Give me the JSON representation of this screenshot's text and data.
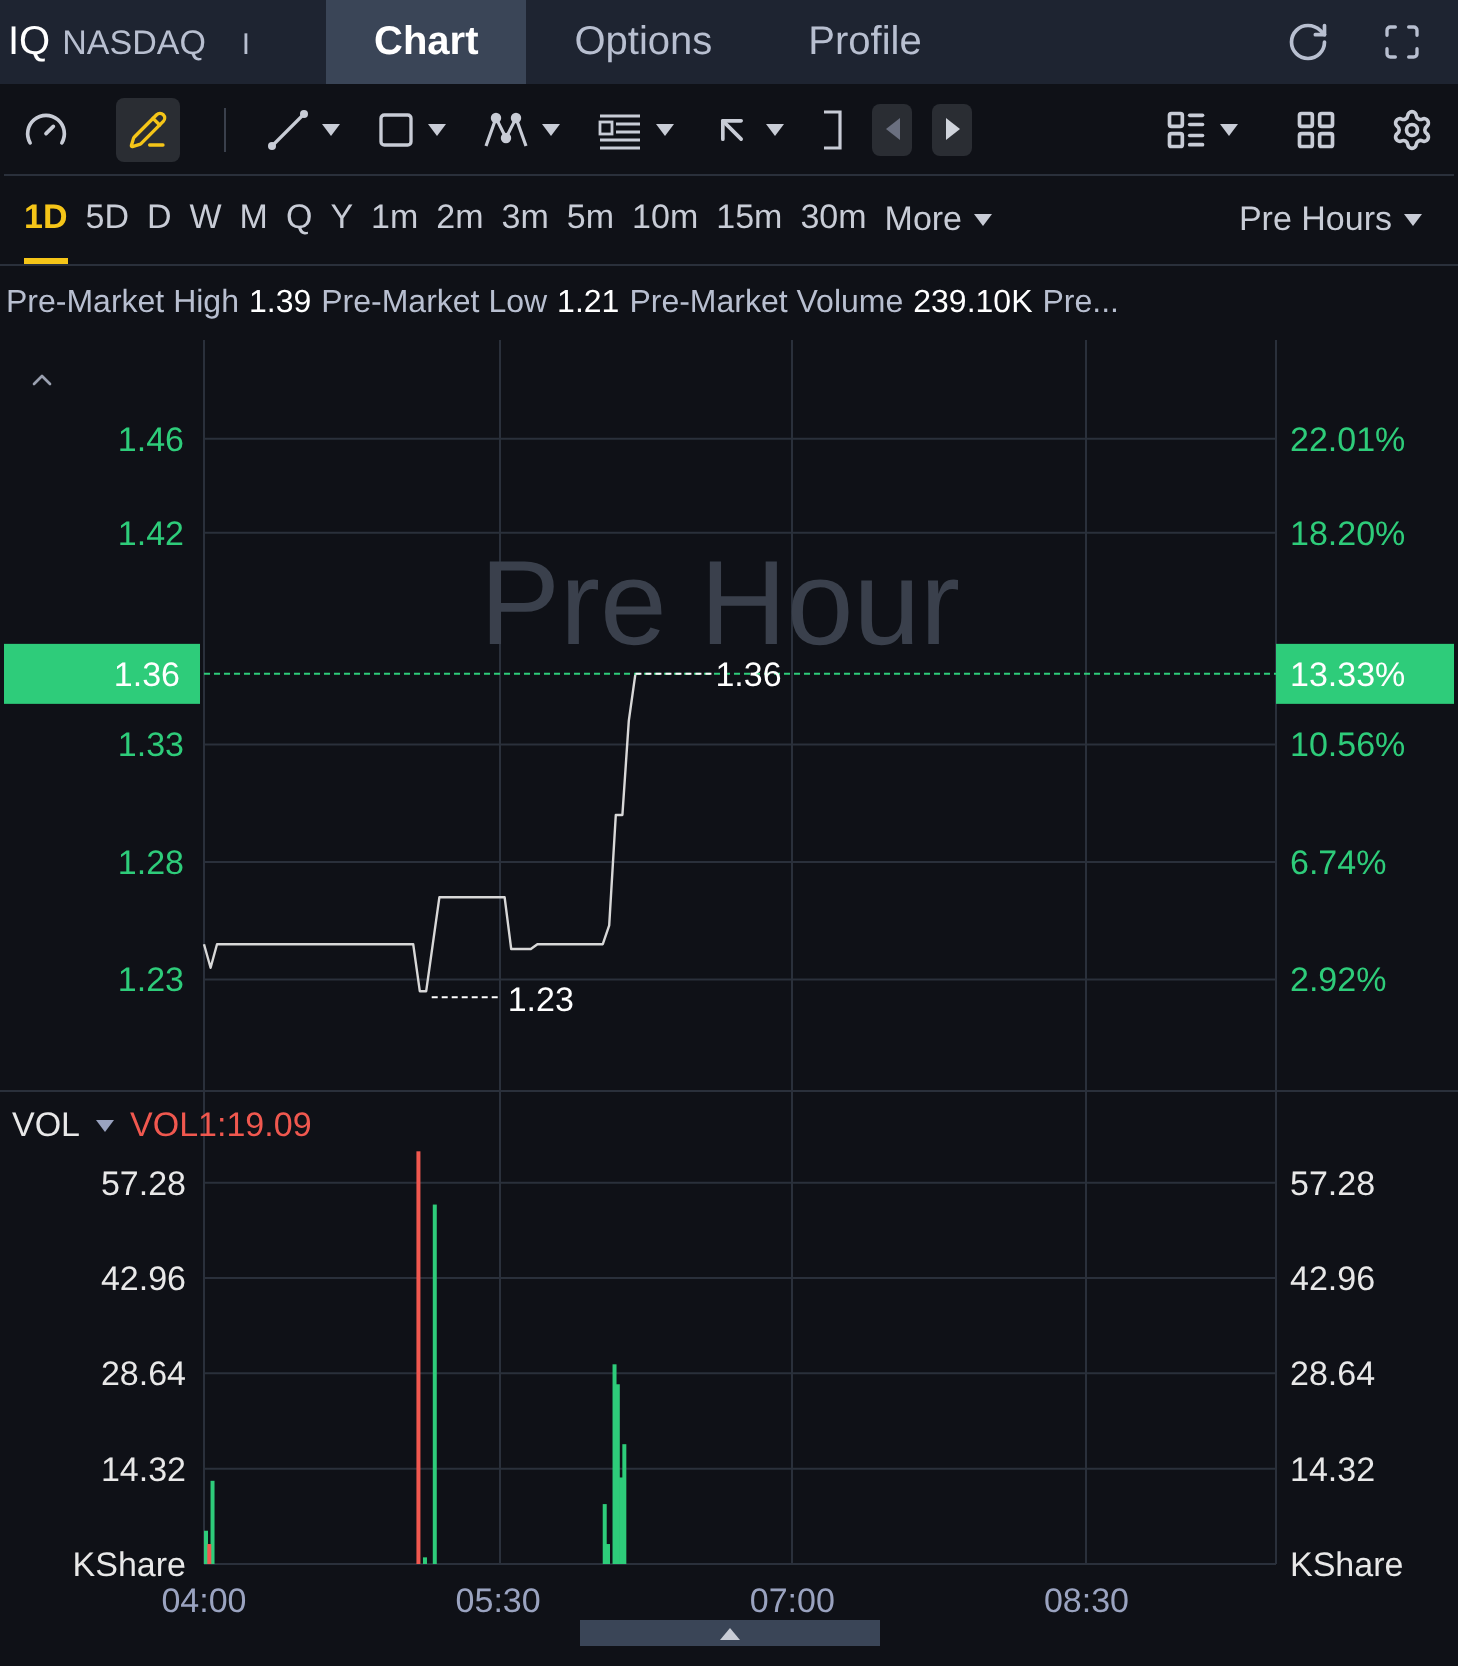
{
  "header": {
    "symbol": "IQ",
    "exchange": "NASDAQ",
    "separator": "I",
    "tabs": [
      {
        "label": "Chart",
        "selected": true
      },
      {
        "label": "Options",
        "selected": false
      },
      {
        "label": "Profile",
        "selected": false
      }
    ]
  },
  "toolbar": {
    "pencil_active": true
  },
  "periods": [
    {
      "label": "1D",
      "selected": true
    },
    {
      "label": "5D",
      "selected": false
    },
    {
      "label": "D",
      "selected": false
    },
    {
      "label": "W",
      "selected": false
    },
    {
      "label": "M",
      "selected": false
    },
    {
      "label": "Q",
      "selected": false
    },
    {
      "label": "Y",
      "selected": false
    },
    {
      "label": "1m",
      "selected": false
    },
    {
      "label": "2m",
      "selected": false
    },
    {
      "label": "3m",
      "selected": false
    },
    {
      "label": "5m",
      "selected": false
    },
    {
      "label": "10m",
      "selected": false
    },
    {
      "label": "15m",
      "selected": false
    },
    {
      "label": "30m",
      "selected": false
    }
  ],
  "more_label": "More",
  "session": "Pre Hours",
  "stats": [
    {
      "label": "Pre-Market High",
      "value": "1.39"
    },
    {
      "label": "Pre-Market Low",
      "value": "1.21"
    },
    {
      "label": "Pre-Market Volume",
      "value": "239.10K"
    },
    {
      "label": "Pre..."
    }
  ],
  "price_chart": {
    "watermark": "Pre Hour",
    "current_change": "13.33%",
    "high_label": "1.36",
    "low_label": "1.23",
    "right_ticks": [
      "22.01%",
      "18.20%",
      "10.56%",
      "6.74%",
      "2.92%"
    ],
    "chart_data": {
      "type": "line",
      "grid": true,
      "ref_lines": [
        {
          "axis": "y",
          "value": 1.36,
          "label": "1.36",
          "color": "#2ecc7a"
        }
      ],
      "ylim": [
        1.183,
        1.502
      ],
      "yticks": [
        1.46,
        1.42,
        1.33,
        1.28,
        1.23
      ],
      "categories": [
        null,
        null,
        null,
        null,
        null,
        null,
        null,
        null,
        null,
        null,
        null,
        null,
        null,
        null,
        null,
        null,
        null,
        null,
        null,
        null,
        null,
        null,
        null,
        null,
        null,
        null,
        null,
        null,
        null,
        null,
        null,
        null,
        null,
        null,
        null,
        null,
        null,
        null,
        null,
        null,
        null,
        null,
        null,
        null,
        null,
        null,
        null,
        null,
        null,
        null,
        null,
        null,
        null,
        null,
        null,
        null,
        null,
        null,
        null,
        null,
        null,
        null,
        null,
        null,
        null,
        null,
        null,
        null,
        null,
        null,
        null,
        null,
        null,
        null,
        null,
        null,
        null,
        null,
        null,
        null,
        null,
        null,
        null,
        null,
        null,
        null,
        null,
        null,
        null,
        null,
        null,
        null,
        null,
        null,
        null,
        null,
        null,
        null,
        null,
        null,
        null,
        null,
        null,
        null,
        null,
        null,
        null,
        null,
        null,
        null,
        null,
        null,
        null,
        null,
        null,
        null,
        null,
        null,
        null,
        null,
        null,
        null,
        null,
        null,
        null,
        null,
        null,
        null,
        null,
        null,
        null,
        null,
        null,
        null,
        null,
        null,
        null,
        null,
        null,
        null,
        null,
        null,
        null,
        null,
        null,
        null,
        null,
        null,
        null,
        null,
        null,
        null,
        null,
        null,
        null,
        null,
        null,
        null,
        null,
        null,
        null,
        null,
        null,
        null,
        null
      ],
      "series": [
        {
          "color": "#d8d8d8",
          "values": [
            1.245,
            1.235,
            1.245,
            1.245,
            1.245,
            1.245,
            1.245,
            1.245,
            1.245,
            1.245,
            1.245,
            1.245,
            1.245,
            1.245,
            1.245,
            1.245,
            1.245,
            1.245,
            1.245,
            1.245,
            1.245,
            1.245,
            1.245,
            1.245,
            1.245,
            1.245,
            1.245,
            1.245,
            1.245,
            1.245,
            1.245,
            1.245,
            1.245,
            1.225,
            1.225,
            1.245,
            1.265,
            1.265,
            1.265,
            1.265,
            1.265,
            1.265,
            1.265,
            1.265,
            1.265,
            1.265,
            1.265,
            1.243,
            1.243,
            1.243,
            1.243,
            1.245,
            1.245,
            1.245,
            1.245,
            1.245,
            1.245,
            1.245,
            1.245,
            1.245,
            1.245,
            1.245,
            1.253,
            1.3,
            1.3,
            1.34,
            1.36,
            null,
            null,
            null,
            null,
            null,
            null,
            null,
            null,
            null,
            null,
            null,
            null,
            null,
            null,
            null,
            null,
            null,
            null,
            null,
            null,
            null,
            null,
            null,
            null,
            null,
            null,
            null,
            null,
            null,
            null,
            null,
            null,
            null,
            null,
            null,
            null,
            null,
            null,
            null,
            null,
            null,
            null,
            null,
            null,
            null,
            null,
            null,
            null,
            null,
            null,
            null,
            null,
            null,
            null,
            null,
            null,
            null,
            null,
            null,
            null,
            null,
            null,
            null,
            null,
            null,
            null,
            null,
            null,
            null,
            null,
            null,
            null,
            null,
            null,
            null,
            null,
            null,
            null,
            null,
            null,
            null,
            null,
            null,
            null,
            null,
            null,
            null,
            null,
            null,
            null,
            null,
            null,
            null,
            null,
            null,
            null,
            null,
            null
          ]
        }
      ]
    }
  },
  "volume_chart": {
    "title": "VOL",
    "indicator": "VOL1:19.09",
    "unit_left": "KShare",
    "unit_right": "KShare",
    "left_ticks": [
      "57.28",
      "42.96",
      "28.64",
      "14.32"
    ],
    "right_ticks": [
      "57.28",
      "42.96",
      "28.64",
      "14.32"
    ],
    "chart_data": {
      "type": "bar",
      "grid": true,
      "xlim": [
        4,
        9.4667
      ],
      "ylim": [
        0,
        70.91
      ],
      "yticks": [
        57.28,
        42.96,
        28.64,
        14.32
      ],
      "xticks": [
        {
          "value": 4,
          "label": "04:00"
        },
        {
          "value": 5.5,
          "label": "05:30"
        },
        {
          "value": 7,
          "label": "07:00"
        },
        {
          "value": 8.5,
          "label": "08:30"
        }
      ],
      "x": [
        4,
        4.0167,
        4.0333,
        5.0833,
        5.1167,
        5.1667,
        6.0333,
        6.05,
        6.0833,
        6.1,
        6.1167,
        6.1333
      ],
      "series": [
        {
          "color": "#2ecc7a",
          "values": [
            5,
            null,
            12.5,
            null,
            1,
            54,
            9,
            3,
            30,
            27,
            13,
            18
          ]
        },
        {
          "color": "#f0584f",
          "values": [
            null,
            3,
            null,
            62,
            null,
            null,
            null,
            null,
            null,
            null,
            null,
            null
          ]
        }
      ]
    }
  }
}
